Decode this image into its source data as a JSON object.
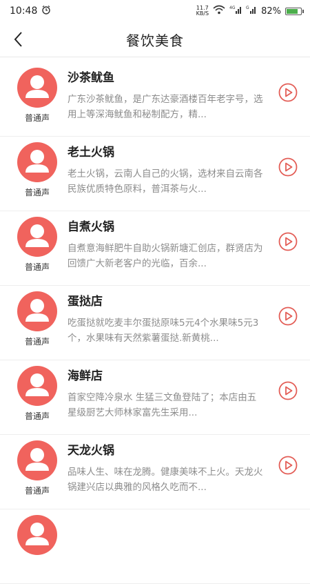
{
  "status_bar": {
    "time": "10:48",
    "net_speed_value": "11.7",
    "net_speed_unit": "KB/S",
    "battery_percent": "82%",
    "battery_level": 0.82
  },
  "header": {
    "title": "餐饮美食"
  },
  "items": [
    {
      "title": "沙茶鱿鱼",
      "voice": "普通声",
      "desc": "广东沙茶鱿鱼，是广东达豪酒楼百年老字号，选用上等深海鱿鱼和秘制配方，精..."
    },
    {
      "title": "老土火锅",
      "voice": "普通声",
      "desc": "老土火锅，云南人自己的火锅，选材来自云南各民族优质特色原料，普洱茶与火..."
    },
    {
      "title": "自煮火锅",
      "voice": "普通声",
      "desc": "自煮意海鲜肥牛自助火锅新塘汇创店，群贤店为回馈广大新老客户的光临，百余..."
    },
    {
      "title": "蛋挞店",
      "voice": "普通声",
      "desc": "吃蛋挞就吃麦丰尔蛋挞原味5元4个水果味5元3个，水果味有天然紫薯蛋挞.新黄桃..."
    },
    {
      "title": "海鲜店",
      "voice": "普通声",
      "desc": "首家空降冷泉水 生猛三文鱼登陆了；本店由五星级厨艺大师林家富先生采用..."
    },
    {
      "title": "天龙火锅",
      "voice": "普通声",
      "desc": "品味人生、味在龙腾。健康美味不上火。天龙火锅建兴店以典雅的风格久吃而不..."
    }
  ]
}
